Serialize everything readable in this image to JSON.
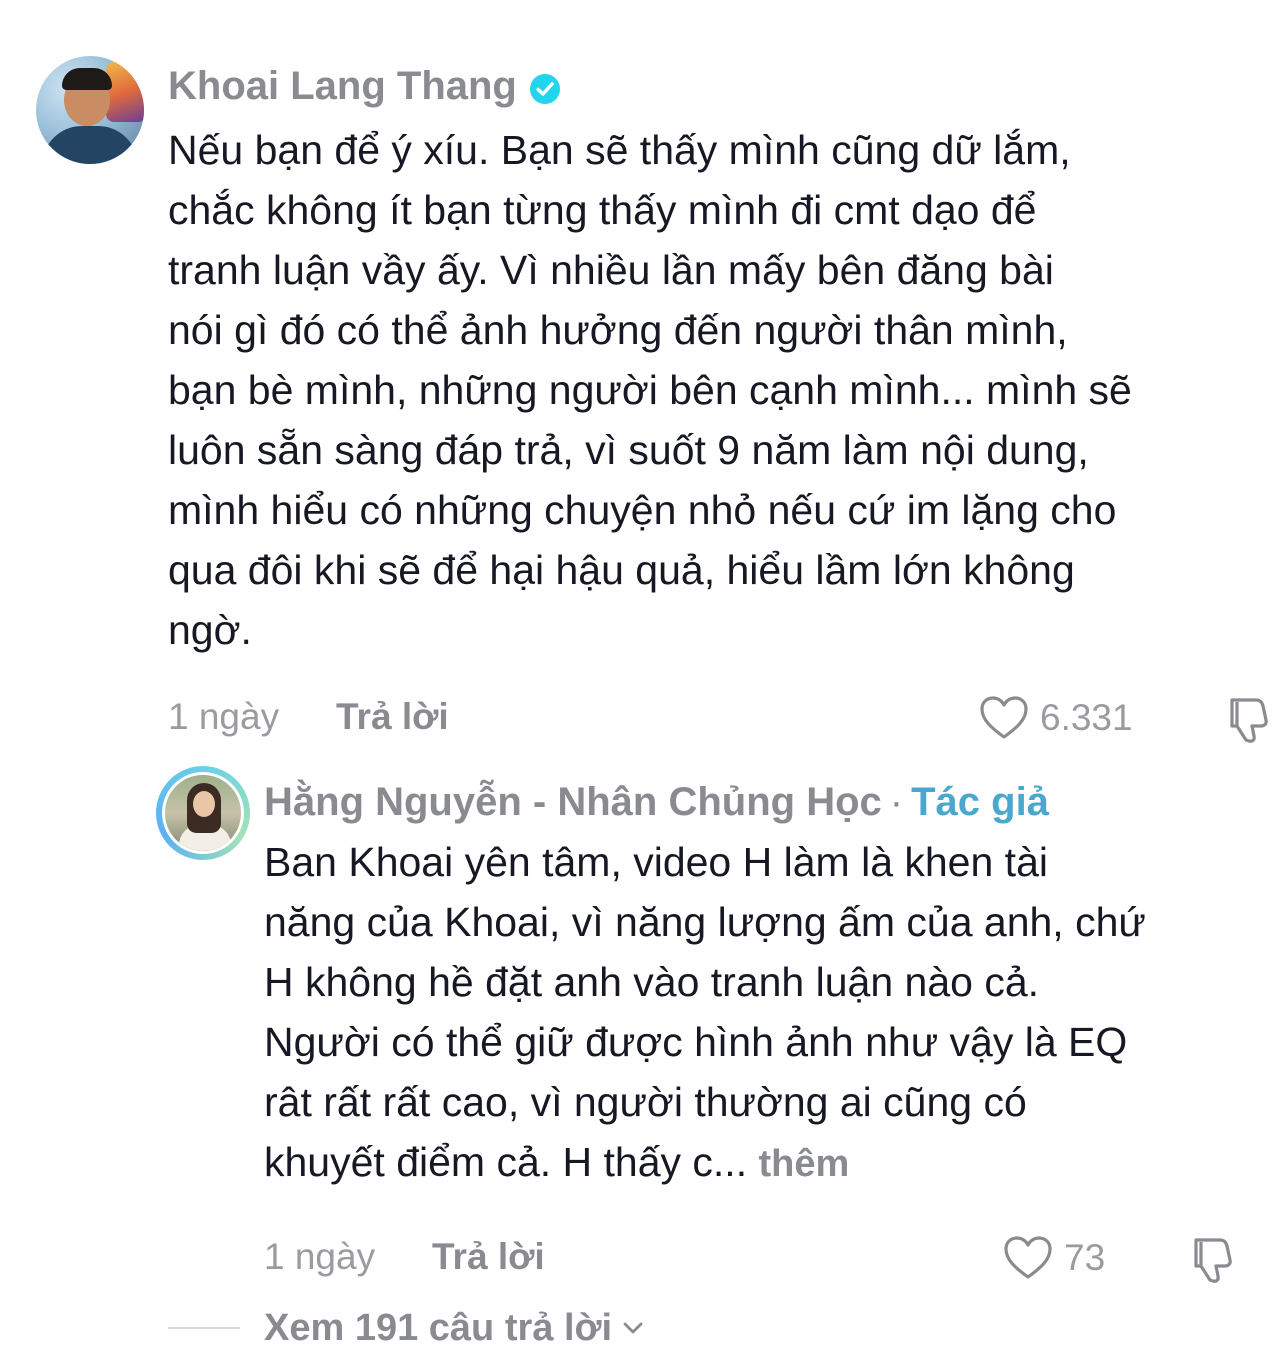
{
  "comments": [
    {
      "author": "Khoai Lang Thang",
      "verified": true,
      "text": "Nếu bạn để ý xíu. Bạn sẽ thấy mình cũng dữ lắm,\nchắc không ít bạn từng thấy mình đi cmt dạo để\ntranh luận vầy ấy. Vì nhiều lần mấy bên đăng bài\nnói gì đó có thể ảnh hưởng đến người thân mình,\nbạn bè mình, những người bên cạnh mình... mình sẽ\nluôn sẵn sàng đáp trả, vì suốt 9 năm làm nội dung,\nmình hiểu có những chuyện nhỏ nếu cứ im lặng cho\nqua đôi khi sẽ để hại hậu quả, hiểu lầm lớn không\nngờ.",
      "time": "1 ngày",
      "reply_label": "Trả lời",
      "likes": "6.331"
    },
    {
      "author": "Hằng Nguyễn - Nhân Chủng Học",
      "separator": "·",
      "author_tag": "Tác giả",
      "text": "Ban Khoai yên tâm, video H làm là khen tài\nnăng của Khoai, vì năng lượng ấm của anh, chứ\nH không hề đặt anh vào tranh luận nào cả.\nNgười có thể giữ được hình ảnh như vậy là EQ\nrât rất rất cao, vì người thường ai cũng có\nkhuyết điểm cả. H thấy c...",
      "more_label": "thêm",
      "time": "1 ngày",
      "reply_label": "Trả lời",
      "likes": "73"
    }
  ],
  "view_replies": {
    "label": "Xem 191 câu trả lời"
  },
  "colors": {
    "text": "#161823",
    "muted": "#8a8b91",
    "author_tag": "#4aa8cf",
    "verified": "#20d5ec"
  },
  "icons": {
    "verified": "verified-badge-icon",
    "like": "heart-outline-icon",
    "dislike": "thumbs-down-icon",
    "expand": "chevron-down-icon"
  }
}
